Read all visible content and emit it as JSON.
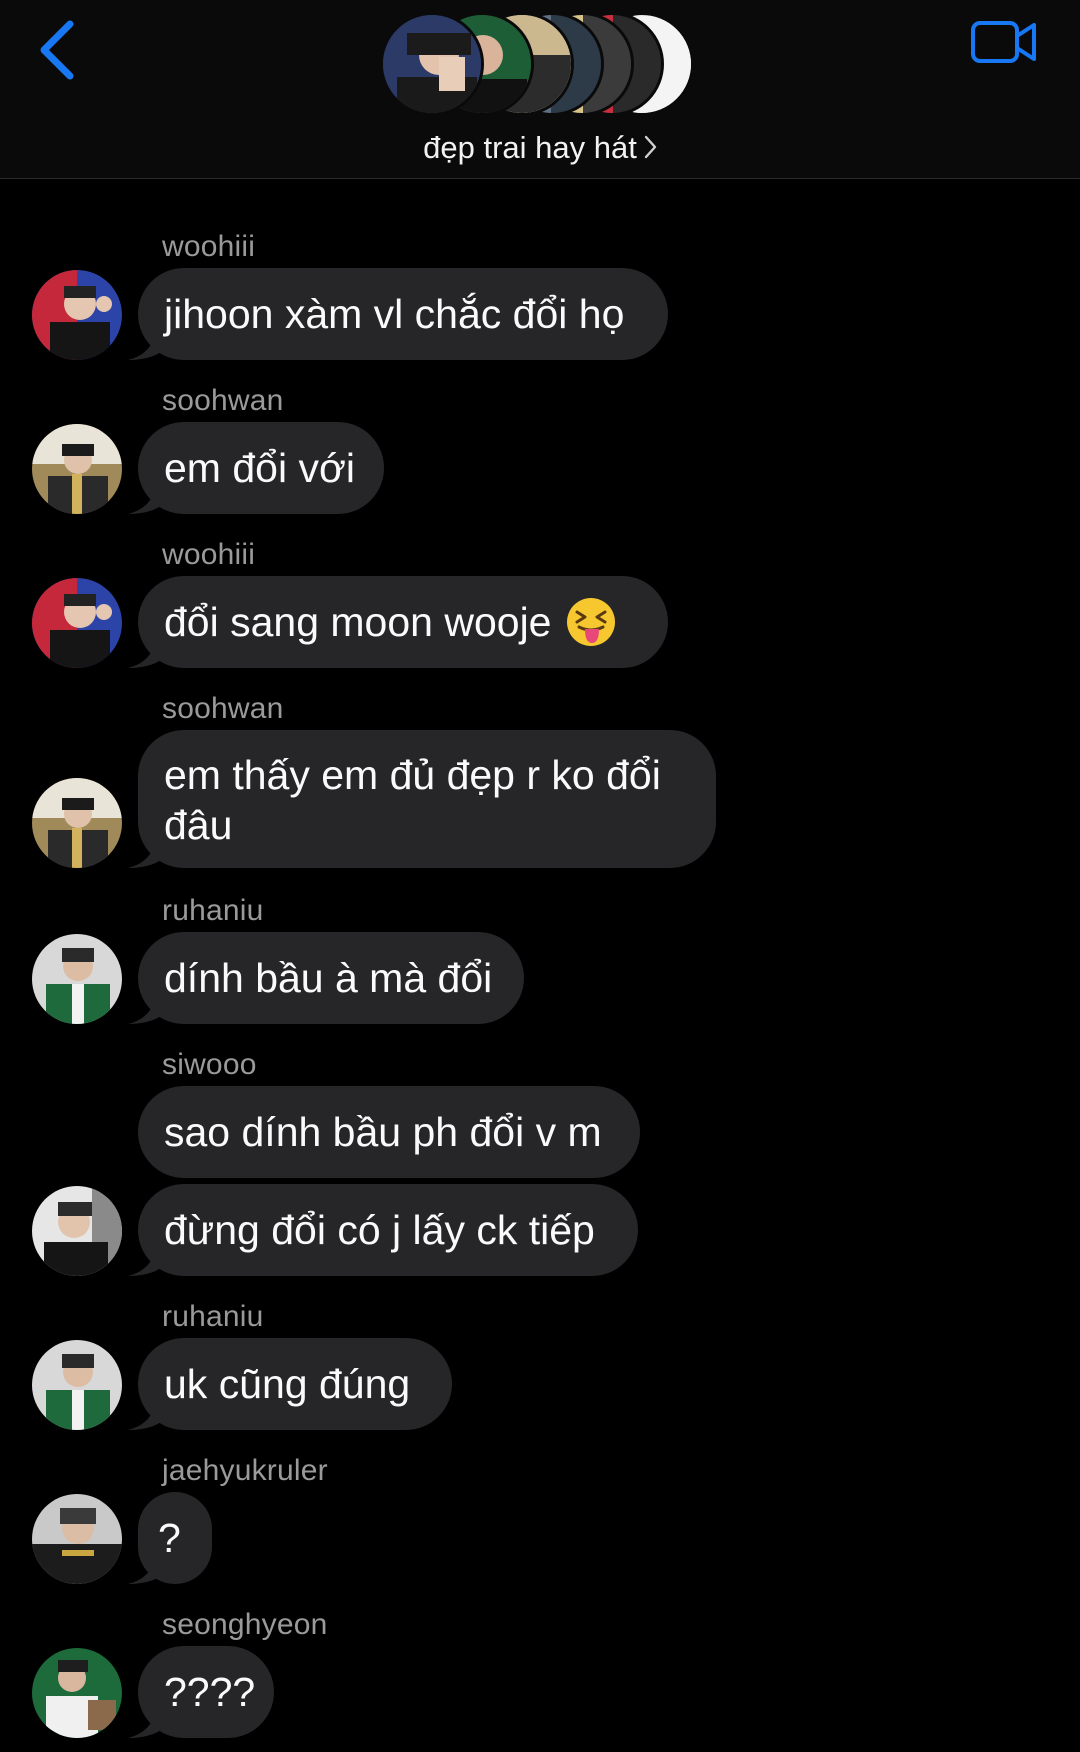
{
  "header": {
    "group_name": "đẹp trai hay hát",
    "back_icon": "chevron-left-icon",
    "video_icon": "video-camera-icon",
    "accent": "#1877f2"
  },
  "messages": [
    {
      "sender": "woohiii",
      "text": "jihoon xàm vl chắc đổi họ"
    },
    {
      "sender": "soohwan",
      "text": "em đổi với"
    },
    {
      "sender": "woohiii",
      "text": "đổi sang moon wooje",
      "emoji": "squinting-face-with-tongue"
    },
    {
      "sender": "soohwan",
      "text_line1": "em thấy em đủ đẹp r ko đổi",
      "text_line2": "đâu"
    },
    {
      "sender": "ruhaniu",
      "text": "dính bầu à mà đổi"
    },
    {
      "sender": "siwooo",
      "text": "sao dính bầu ph đổi v m"
    },
    {
      "sender": "",
      "text": "đừng đổi có j lấy ck tiếp"
    },
    {
      "sender": "ruhaniu",
      "text": "uk cũng đúng"
    },
    {
      "sender": "jaehyukruler",
      "text": "?"
    },
    {
      "sender": "seonghyeon",
      "text": "????"
    }
  ]
}
